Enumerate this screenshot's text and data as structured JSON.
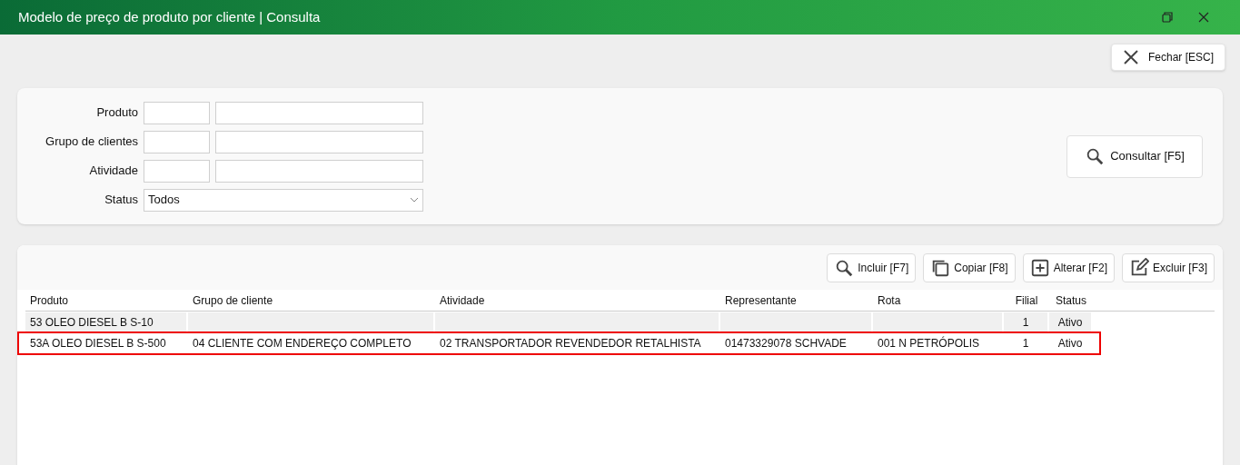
{
  "window": {
    "title": "Modelo de preço de produto por cliente | Consulta"
  },
  "close_button": {
    "label": "Fechar [ESC]"
  },
  "filters": [
    {
      "kind": "lookup",
      "label": "Produto"
    },
    {
      "kind": "lookup",
      "label": "Grupo de clientes"
    },
    {
      "kind": "lookup",
      "label": "Atividade"
    },
    {
      "kind": "select",
      "label": "Status",
      "value": "Todos"
    }
  ],
  "search_button": {
    "label": "Consultar [F5]"
  },
  "toolbar": [
    {
      "kind": "search",
      "label": "Incluir [F7]"
    },
    {
      "kind": "copy",
      "label": "Copiar [F8]"
    },
    {
      "kind": "add",
      "label": "Alterar [F2]"
    },
    {
      "kind": "edit",
      "label": "Excluir [F3]"
    }
  ],
  "table": {
    "columns": [
      "Produto",
      "Grupo de cliente",
      "Atividade",
      "Representante",
      "Rota",
      "Filial",
      "Status"
    ],
    "rows": [
      {
        "highlighted": false,
        "cells": [
          "53 OLEO DIESEL B S-10",
          "",
          "",
          "",
          "",
          "1",
          "Ativo"
        ]
      },
      {
        "highlighted": true,
        "cells": [
          "53A OLEO DIESEL B S-500",
          "04 CLIENTE COM ENDEREÇO COMPLETO",
          "02 TRANSPORTADOR REVENDEDOR RETALHISTA",
          "01473329078 SCHVADE",
          "001 N PETRÓPOLIS",
          "1",
          "Ativo"
        ]
      }
    ]
  }
}
